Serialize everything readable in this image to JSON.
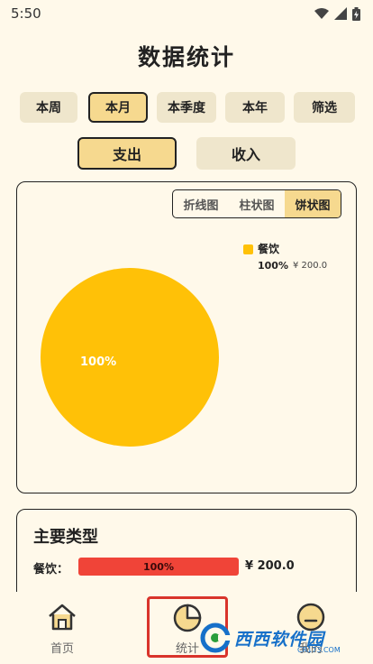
{
  "status_bar": {
    "time": "5:50",
    "wifi_icon": "wifi-icon",
    "signal_icon": "signal-icon",
    "battery_icon": "battery-icon"
  },
  "page_title": "数据统计",
  "periods": [
    {
      "label": "本周",
      "active": false
    },
    {
      "label": "本月",
      "active": true
    },
    {
      "label": "本季度",
      "active": false
    },
    {
      "label": "本年",
      "active": false
    },
    {
      "label": "筛选",
      "active": false
    }
  ],
  "types": [
    {
      "label": "支出",
      "active": true
    },
    {
      "label": "收入",
      "active": false
    }
  ],
  "chart_tabs": [
    {
      "label": "折线图",
      "active": false
    },
    {
      "label": "柱状图",
      "active": false
    },
    {
      "label": "饼状图",
      "active": true
    }
  ],
  "chart_data": {
    "type": "pie",
    "slices": [
      {
        "label": "餐饮",
        "value": 200.0,
        "percent": "100%",
        "amount": "¥ 200.0",
        "color": "#ffc107"
      }
    ]
  },
  "summary": {
    "title": "主要类型",
    "items": [
      {
        "label": "餐饮：",
        "percent_text": "100%",
        "fraction": 1.0,
        "amount": "¥ 200.0",
        "color": "#f04438"
      }
    ]
  },
  "nav": [
    {
      "label": "首页",
      "icon": "home-icon"
    },
    {
      "label": "统计",
      "icon": "pie-chart-icon"
    },
    {
      "label": "我的",
      "icon": "profile-icon"
    }
  ],
  "watermark": {
    "text": "西西软件园",
    "sub": "CR173.COM"
  },
  "colors": {
    "accent": "#f6d98f",
    "pie": "#ffc107",
    "bar": "#f04438",
    "highlight": "#d9342b"
  }
}
